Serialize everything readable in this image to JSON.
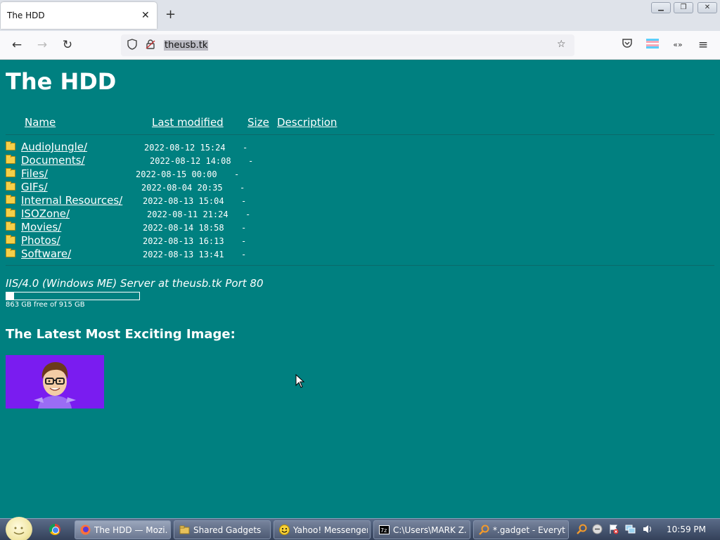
{
  "browser": {
    "tab_title": "The HDD",
    "tab_close": "✕",
    "new_tab": "+",
    "url": "theusb.tk",
    "window_buttons": [
      "▁",
      "❐",
      "✕"
    ]
  },
  "page": {
    "title": "The HDD",
    "columns": {
      "name": "Name",
      "last_modified": "Last modified",
      "size": "Size",
      "description": "Description"
    },
    "entries": [
      {
        "name": "AudioJungle/",
        "modified": "2022-08-12 15:24",
        "size": "-"
      },
      {
        "name": "Documents/",
        "modified": "2022-08-12 14:08",
        "size": "-"
      },
      {
        "name": "Files/",
        "modified": "2022-08-15 00:00",
        "size": "-"
      },
      {
        "name": "GIFs/",
        "modified": "2022-08-04 20:35",
        "size": "-"
      },
      {
        "name": "Internal Resources/",
        "modified": "2022-08-13 15:04",
        "size": "-"
      },
      {
        "name": "ISOZone/",
        "modified": "2022-08-11 21:24",
        "size": "-"
      },
      {
        "name": "Movies/",
        "modified": "2022-08-14 18:58",
        "size": "-"
      },
      {
        "name": "Photos/",
        "modified": "2022-08-13 16:13",
        "size": "-"
      },
      {
        "name": "Software/",
        "modified": "2022-08-13 13:41",
        "size": "-"
      }
    ],
    "server_line": "IIS/4.0 (Windows ME) Server at theusb.tk Port 80",
    "disk": {
      "text": "863 GB free of 915 GB",
      "used_fraction": 0.057
    },
    "latest_heading": "The Latest Most Exciting Image:"
  },
  "taskbar": {
    "tasks": [
      {
        "label": "The HDD — Mozi...",
        "icon": "firefox-icon"
      },
      {
        "label": "Shared Gadgets",
        "icon": "folder-icon"
      },
      {
        "label": "Yahoo! Messenger",
        "icon": "smiley-icon"
      },
      {
        "label": "C:\\Users\\MARK Z...",
        "icon": "7zip-icon"
      },
      {
        "label": "*.gadget - Everyt...",
        "icon": "search-icon"
      }
    ],
    "clock": "10:59 PM"
  },
  "colors": {
    "page_bg": "#008080",
    "image_bg": "#7a1cf0",
    "folder": "#f5d04a"
  }
}
